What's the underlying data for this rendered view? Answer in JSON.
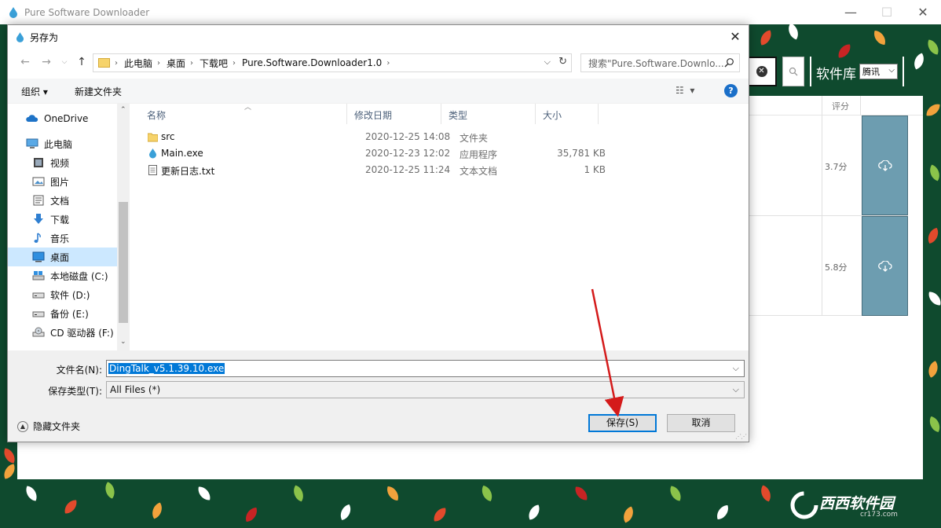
{
  "app": {
    "title": "Pure Software Downloader",
    "library_label": "软件库",
    "library_selected": "腾讯",
    "results": {
      "score_header": "评分",
      "rows": [
        {
          "score": "3.7分"
        },
        {
          "score": "5.8分"
        }
      ]
    }
  },
  "dialog": {
    "title": "另存为",
    "breadcrumb": [
      "此电脑",
      "桌面",
      "下载吧",
      "Pure.Software.Downloader1.0"
    ],
    "search_placeholder": "搜索\"Pure.Software.Downlo...",
    "toolbar": {
      "organize": "组织 ▾",
      "new_folder": "新建文件夹"
    },
    "nav": [
      {
        "label": "OneDrive",
        "icon": "cloud-icon"
      },
      {
        "label": "此电脑",
        "icon": "computer-icon"
      },
      {
        "label": "视频",
        "icon": "video-icon"
      },
      {
        "label": "图片",
        "icon": "picture-icon"
      },
      {
        "label": "文档",
        "icon": "document-icon"
      },
      {
        "label": "下载",
        "icon": "download-icon"
      },
      {
        "label": "音乐",
        "icon": "music-icon"
      },
      {
        "label": "桌面",
        "icon": "desktop-icon"
      },
      {
        "label": "本地磁盘 (C:)",
        "icon": "drive-c-icon"
      },
      {
        "label": "软件 (D:)",
        "icon": "drive-icon"
      },
      {
        "label": "备份 (E:)",
        "icon": "drive-icon"
      },
      {
        "label": "CD 驱动器 (F:)",
        "icon": "cd-drive-icon"
      }
    ],
    "columns": {
      "name": "名称",
      "date": "修改日期",
      "type": "类型",
      "size": "大小"
    },
    "files": [
      {
        "name": "src",
        "date": "2020-12-25 14:08",
        "type": "文件夹",
        "size": "",
        "icon": "folder-icon"
      },
      {
        "name": "Main.exe",
        "date": "2020-12-23 12:02",
        "type": "应用程序",
        "size": "35,781 KB",
        "icon": "app-drop-icon"
      },
      {
        "name": "更新日志.txt",
        "date": "2020-12-25 11:24",
        "type": "文本文档",
        "size": "1 KB",
        "icon": "text-file-icon"
      }
    ],
    "filename_label": "文件名(N):",
    "filename_value": "DingTalk_v5.1.39.10.exe",
    "filetype_label": "保存类型(T):",
    "filetype_value": "All Files (*)",
    "hide_folders": "隐藏文件夹",
    "save_button": "保存(S)",
    "cancel_button": "取消"
  },
  "watermark": {
    "brand": "西西软件园",
    "url": "cr173.com"
  },
  "colors": {
    "accent": "#0078d7",
    "download_button": "#6d9db0",
    "background_green": "#0f4a2e",
    "annotation_red": "#d41a1a"
  }
}
